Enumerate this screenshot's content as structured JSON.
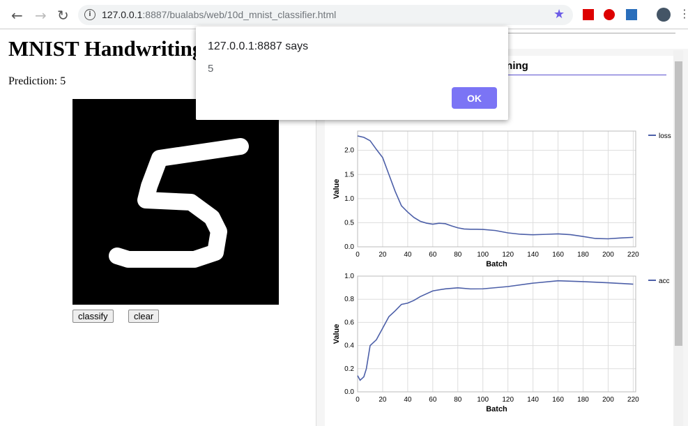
{
  "browser": {
    "url_host": "127.0.0.1",
    "url_rest": ":8887/bualabs/web/10d_mnist_classifier.html",
    "icons": [
      "back-icon",
      "forward-icon",
      "reload-icon",
      "info-icon",
      "bookmark-star-icon",
      "lastpass-icon",
      "adblock-icon",
      "extension-s-icon",
      "profile-avatar",
      "menu-icon"
    ]
  },
  "page": {
    "title": "MNIST Handwriting Recognition",
    "prediction": "Prediction: 5",
    "classify_label": "classify",
    "clear_label": "clear",
    "canvas_digit": "5"
  },
  "visor": {
    "title": "Model Training"
  },
  "dialog": {
    "title": "127.0.0.1:8887 says",
    "message": "5",
    "ok_label": "OK"
  },
  "colors": {
    "series": "#4c5fa8",
    "accent": "#7b74f5"
  },
  "chart_data": [
    {
      "type": "line",
      "xlabel": "Batch",
      "ylabel": "Value",
      "legend": "loss",
      "legend_position": "right",
      "grid": true,
      "xlim": [
        0,
        222
      ],
      "ylim": [
        0,
        2.4
      ],
      "xticks": [
        0,
        20,
        40,
        60,
        80,
        100,
        120,
        140,
        160,
        180,
        200,
        220
      ],
      "yticks": [
        0,
        0.5,
        1.0,
        1.5,
        2.0
      ],
      "ytick_labels": [
        "0.0",
        "0.5",
        "1.0",
        "1.5",
        "2.0"
      ],
      "x": [
        0,
        5,
        10,
        15,
        20,
        25,
        30,
        35,
        40,
        45,
        50,
        55,
        60,
        65,
        70,
        75,
        80,
        85,
        90,
        95,
        100,
        110,
        120,
        130,
        140,
        150,
        160,
        170,
        180,
        190,
        200,
        210,
        220
      ],
      "values": [
        2.3,
        2.27,
        2.2,
        2.02,
        1.85,
        1.5,
        1.15,
        0.85,
        0.72,
        0.6,
        0.55,
        0.52,
        0.48,
        0.47,
        0.45,
        0.42,
        0.41,
        0.4,
        0.38,
        0.35,
        0.33,
        0.32,
        0.3,
        0.29,
        0.27,
        0.25,
        0.24,
        0.23,
        0.22,
        0.2,
        0.19,
        0.18,
        0.17
      ]
    },
    {
      "type": "line",
      "xlabel": "Batch",
      "ylabel": "Value",
      "legend": "acc",
      "legend_position": "right",
      "grid": true,
      "xlim": [
        0,
        222
      ],
      "ylim": [
        0,
        1.0
      ],
      "xticks": [
        0,
        20,
        40,
        60,
        80,
        100,
        120,
        140,
        160,
        180,
        200,
        220
      ],
      "yticks": [
        0,
        0.2,
        0.4,
        0.6,
        0.8,
        1.0
      ],
      "ytick_labels": [
        "0.0",
        "0.2",
        "0.4",
        "0.6",
        "0.8",
        "1.0"
      ],
      "x": [
        0,
        2,
        5,
        7,
        10,
        15,
        20,
        25,
        30,
        35,
        40,
        45,
        50,
        60,
        70,
        80,
        90,
        100,
        120,
        140,
        160,
        180,
        200,
        220
      ],
      "values": [
        0.14,
        0.1,
        0.13,
        0.2,
        0.4,
        0.45,
        0.55,
        0.65,
        0.7,
        0.75,
        0.78,
        0.81,
        0.83,
        0.86,
        0.87,
        0.89,
        0.9,
        0.91,
        0.92,
        0.93,
        0.94,
        0.94,
        0.95,
        0.95
      ]
    }
  ]
}
